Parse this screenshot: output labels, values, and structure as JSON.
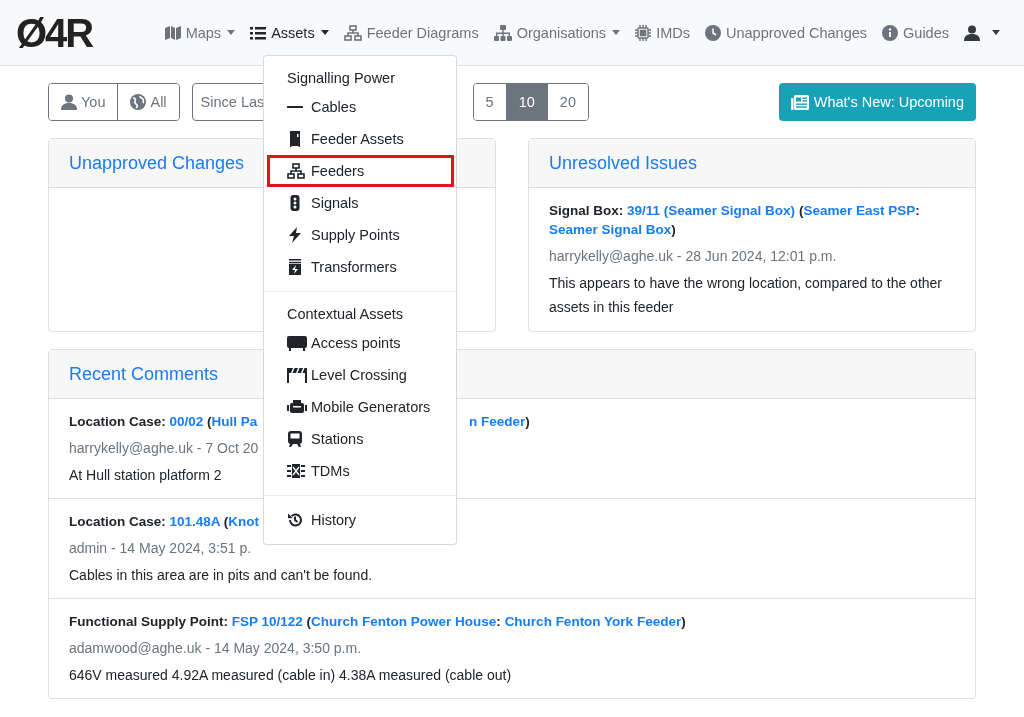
{
  "brand": "Ø4R",
  "nav": [
    {
      "label": "Maps",
      "caret": true,
      "active": false
    },
    {
      "label": "Assets",
      "caret": true,
      "active": true
    },
    {
      "label": "Feeder Diagrams",
      "caret": false,
      "active": false
    },
    {
      "label": "Organisations",
      "caret": true,
      "active": false
    },
    {
      "label": "IMDs",
      "caret": false,
      "active": false
    },
    {
      "label": "Unapproved Changes",
      "caret": false,
      "active": false
    },
    {
      "label": "Guides",
      "caret": false,
      "active": false
    }
  ],
  "user_menu": {
    "caret": true
  },
  "assets_menu": {
    "sections": [
      {
        "header": "Signalling Power",
        "items": [
          {
            "label": "Cables",
            "highlighted": false
          },
          {
            "label": "Feeder Assets",
            "highlighted": false
          },
          {
            "label": "Feeders",
            "highlighted": true
          },
          {
            "label": "Signals",
            "highlighted": false
          },
          {
            "label": "Supply Points",
            "highlighted": false
          },
          {
            "label": "Transformers",
            "highlighted": false
          }
        ]
      },
      {
        "header": "Contextual Assets",
        "items": [
          {
            "label": "Access points",
            "highlighted": false
          },
          {
            "label": "Level Crossing",
            "highlighted": false
          },
          {
            "label": "Mobile Generators",
            "highlighted": false
          },
          {
            "label": "Stations",
            "highlighted": false
          },
          {
            "label": "TDMs",
            "highlighted": false
          }
        ]
      },
      {
        "items": [
          {
            "label": "History",
            "highlighted": false
          }
        ]
      }
    ]
  },
  "scope_toggle": [
    {
      "label": "You",
      "selected": false
    },
    {
      "label": "All",
      "selected": false
    }
  ],
  "period_select": {
    "value": "Since Las"
  },
  "page_sizes": [
    {
      "label": "5",
      "selected": false
    },
    {
      "label": "10",
      "selected": true
    },
    {
      "label": "20",
      "selected": false
    }
  ],
  "whats_new_button": {
    "label": "What's New: Upcoming"
  },
  "unapproved_changes": {
    "title": "Unapproved Changes"
  },
  "unresolved_issues": {
    "title": "Unresolved Issues",
    "issues": [
      {
        "header": [
          {
            "kind": "label",
            "text": "Signal Box:"
          },
          {
            "kind": "link",
            "text": "39/11 (Seamer Signal Box)"
          },
          {
            "kind": "open",
            "text": "("
          },
          {
            "kind": "link",
            "text": "Seamer East PSP"
          },
          {
            "kind": "colon",
            "text": ":"
          },
          {
            "kind": "link",
            "text": "Seamer Signal Box"
          },
          {
            "kind": "close",
            "text": ")"
          }
        ],
        "meta": "harrykelly@aghe.uk - 28 Jun 2024, 12:01 p.m.",
        "body": "This appears to have the wrong location, compared to the other assets in this feeder"
      }
    ]
  },
  "recent_comments": {
    "title": "Recent Comments",
    "comments": [
      {
        "header": [
          {
            "kind": "label",
            "text": "Location Case:"
          },
          {
            "kind": "link",
            "text": "00/02"
          },
          {
            "kind": "open",
            "text": "("
          },
          {
            "kind": "link",
            "text": "Hull Pa"
          }
        ],
        "header_after_menu": [
          {
            "kind": "link",
            "text": "n Feeder"
          },
          {
            "kind": "close",
            "text": ")"
          }
        ],
        "meta": "harrykelly@aghe.uk - 7 Oct 20",
        "body": "At Hull station platform 2"
      },
      {
        "header": [
          {
            "kind": "label",
            "text": "Location Case:"
          },
          {
            "kind": "link",
            "text": "101.48A"
          },
          {
            "kind": "open",
            "text": "("
          },
          {
            "kind": "link",
            "text": "Knot"
          }
        ],
        "meta": "admin - 14 May 2024, 3:51 p.",
        "body": "Cables in this area are in pits and can't be found."
      },
      {
        "header": [
          {
            "kind": "label",
            "text": "Functional Supply Point:"
          },
          {
            "kind": "link",
            "text": "FSP 10/122"
          },
          {
            "kind": "open",
            "text": "("
          },
          {
            "kind": "link",
            "text": "Church Fenton Power House"
          },
          {
            "kind": "colon",
            "text": ":"
          },
          {
            "kind": "link",
            "text": "Church Fenton York Feeder"
          },
          {
            "kind": "close",
            "text": ")"
          }
        ],
        "meta": "adamwood@aghe.uk - 14 May 2024, 3:50 p.m.",
        "body": "646V measured 4.92A measured (cable in) 4.38A measured (cable out)"
      }
    ]
  }
}
